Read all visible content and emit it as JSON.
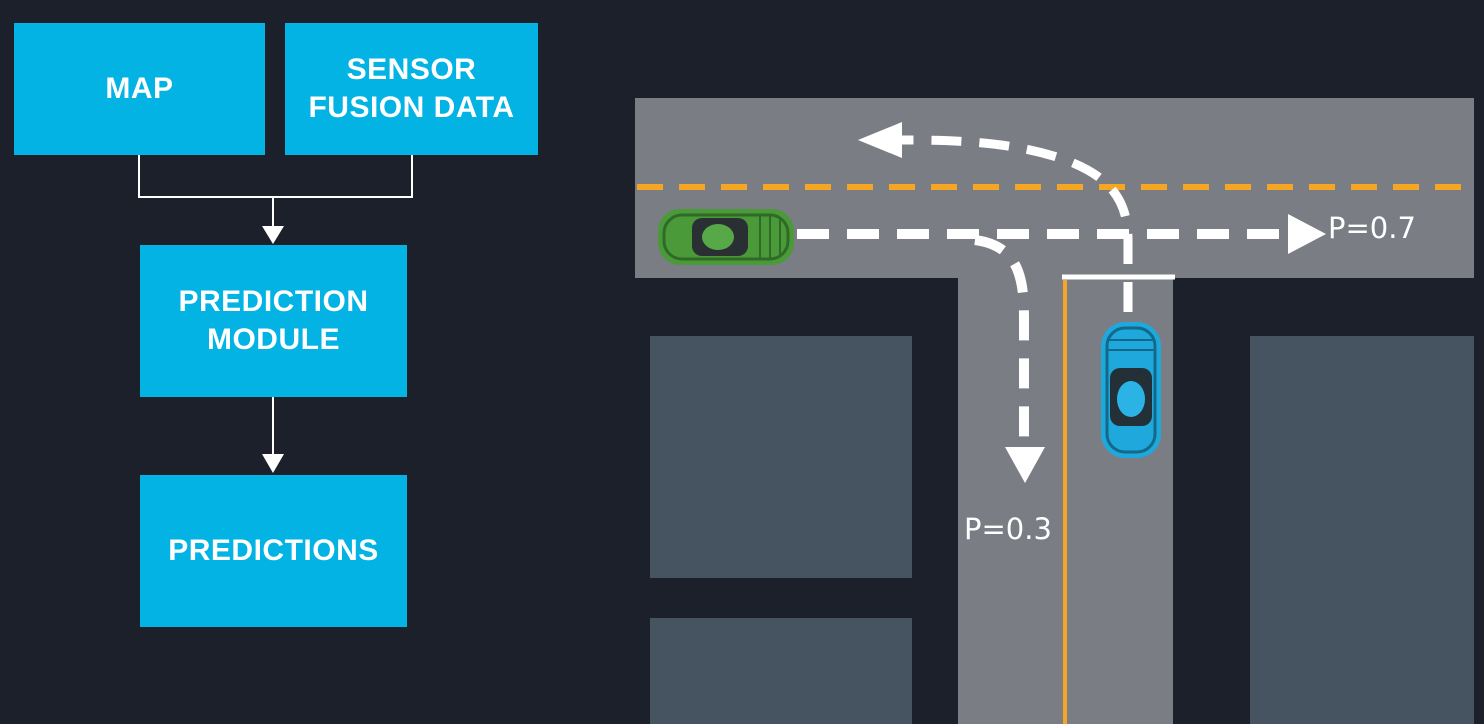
{
  "flowchart": {
    "nodes": {
      "map": "MAP",
      "sensor_fusion": "SENSOR\nFUSION DATA",
      "prediction_module": "PREDICTION\nMODULE",
      "predictions": "PREDICTIONS"
    }
  },
  "scene": {
    "probabilities": {
      "straight": "P=0.7",
      "right_turn": "P=0.3"
    },
    "colors": {
      "background": "#1c202a",
      "box": "#02b3e4",
      "road": "#7a7d84",
      "block": "#465360",
      "center_line": "#f5a623",
      "green_car": "#4a9a3a",
      "blue_car": "#1fa8dc"
    }
  }
}
